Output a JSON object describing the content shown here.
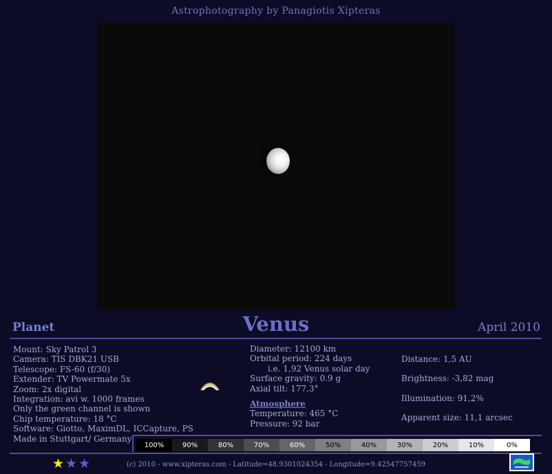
{
  "site_title": "Astrophotography by Panagiotis Xipteras",
  "header": {
    "left": "Planet",
    "center": "Venus",
    "right": "April 2010"
  },
  "specs": [
    "Mount: Sky Patrol 3",
    "Camera: TIS DBK21 USB",
    "Telescope: FS-60 (f/30)",
    "Extender: TV Powermate 5x",
    "Zoom: 2x digital",
    "Integration: avi w. 1000 frames",
    "Only the green channel is shown",
    "Chip temperature: 18 °C",
    "Software: Giotto, MaximDL, ICCapture, PS",
    "Made in Stuttgart/ Germany"
  ],
  "planet_info": {
    "diameter": "Diameter: 12100 km",
    "orbital_period": "Orbital period: 224 days",
    "solar_day": "i.e. 1,92 Venus solar day",
    "surface_gravity": "Surface gravity: 0.9 g",
    "axial_tilt": "Axial tilt: 177,3°",
    "atmosphere_heading": "Atmosphere",
    "temperature": "Temperature: 465 °C",
    "pressure": "Pressure: 92 bar"
  },
  "observation": {
    "distance": "Distance: 1,5 AU",
    "brightness": "Brightness: -3,82 mag",
    "illumination": "Illumination: 91,2%",
    "apparent_size": "Apparent size: 11,1 arcsec"
  },
  "scale": [
    {
      "label": "100%",
      "bg": "#000000",
      "fg": "#ffffff"
    },
    {
      "label": "90%",
      "bg": "#1a1a1a",
      "fg": "#ffffff"
    },
    {
      "label": "80%",
      "bg": "#333333",
      "fg": "#ffffff"
    },
    {
      "label": "70%",
      "bg": "#4d4d4d",
      "fg": "#ffffff"
    },
    {
      "label": "60%",
      "bg": "#666666",
      "fg": "#ffffff"
    },
    {
      "label": "50%",
      "bg": "#808080",
      "fg": "#000000"
    },
    {
      "label": "40%",
      "bg": "#999999",
      "fg": "#000000"
    },
    {
      "label": "30%",
      "bg": "#b3b3b3",
      "fg": "#000000"
    },
    {
      "label": "20%",
      "bg": "#cccccc",
      "fg": "#000000"
    },
    {
      "label": "10%",
      "bg": "#e6e6e6",
      "fg": "#000000"
    },
    {
      "label": "0%",
      "bg": "#ffffff",
      "fg": "#000000"
    }
  ],
  "rating": {
    "value": 1,
    "max": 3,
    "on_color": "#ffee00",
    "off_color": "#5a5fc0"
  },
  "footer": "(c) 2010 - www.xipteras.com - Latitude=48.9301024354 - Longitude=9.42547757459"
}
